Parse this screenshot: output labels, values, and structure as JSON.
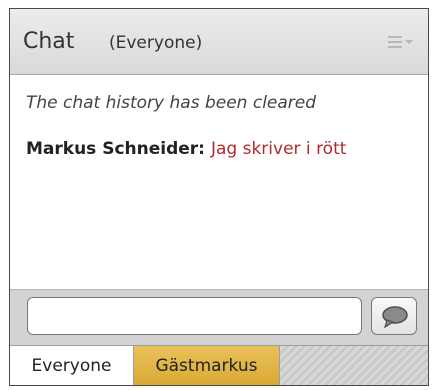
{
  "header": {
    "title": "Chat",
    "subtitle": "(Everyone)",
    "menu_icon": "menu-lines-icon"
  },
  "messages": {
    "system": "The chat history has been cleared",
    "items": [
      {
        "sender": "Markus Schneider:",
        "text": "Jag skriver i rött",
        "text_color": "#b02b2b"
      }
    ]
  },
  "input": {
    "value": "",
    "placeholder": "",
    "send_icon": "speech-bubble-icon"
  },
  "tabs": [
    {
      "label": "Everyone",
      "active": false
    },
    {
      "label": "Gästmarkus",
      "active": true,
      "color": "#e0b246"
    }
  ]
}
